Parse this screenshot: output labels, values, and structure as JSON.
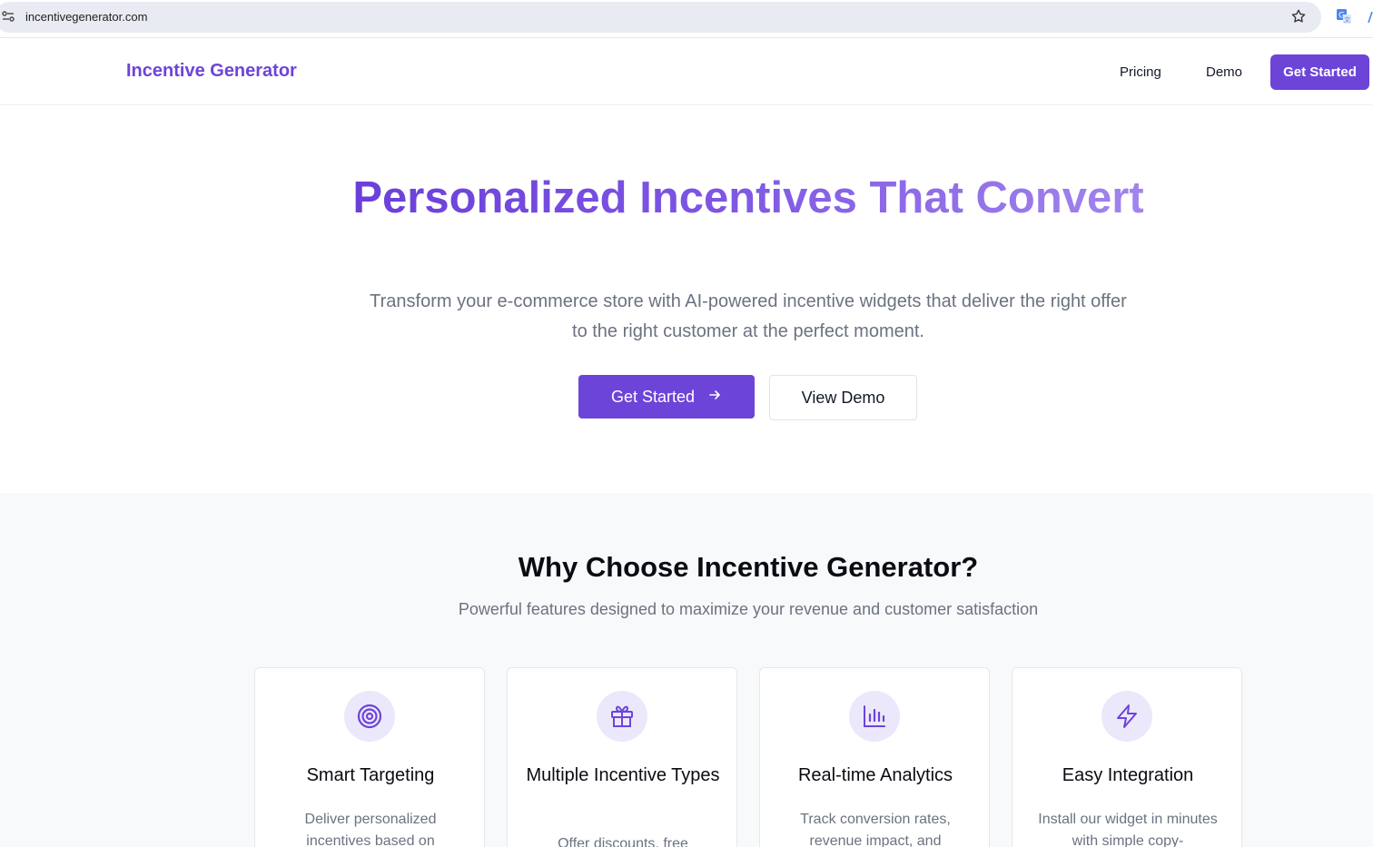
{
  "browser": {
    "url": "incentivegenerator.com",
    "icons": [
      "site-info-icon",
      "bookmark-star-icon",
      "translate-icon"
    ]
  },
  "nav": {
    "brand": "Incentive Generator",
    "links": [
      "Pricing",
      "Demo"
    ],
    "cta": "Get Started"
  },
  "hero": {
    "title": "Personalized Incentives That Convert",
    "subtitle": "Transform your e-commerce store with AI-powered incentive widgets that deliver the right offer to the right customer at the perfect moment.",
    "primary_button": "Get Started",
    "secondary_button": "View Demo"
  },
  "features": {
    "title": "Why Choose Incentive Generator?",
    "subtitle": "Powerful features designed to maximize your revenue and customer satisfaction",
    "cards": [
      {
        "icon": "target-icon",
        "title": "Smart Targeting",
        "desc": "Deliver personalized incentives based on"
      },
      {
        "icon": "gift-icon",
        "title": "Multiple Incentive Types",
        "desc": "Offer discounts, free"
      },
      {
        "icon": "bar-chart-icon",
        "title": "Real-time Analytics",
        "desc": "Track conversion rates, revenue impact, and"
      },
      {
        "icon": "lightning-icon",
        "title": "Easy Integration",
        "desc": "Install our widget in minutes with simple copy-"
      }
    ]
  },
  "colors": {
    "brand": "#6d44d8",
    "icon_bg": "#ece8fb",
    "muted_text": "#6b7280",
    "section_bg": "#f8f9fb"
  }
}
